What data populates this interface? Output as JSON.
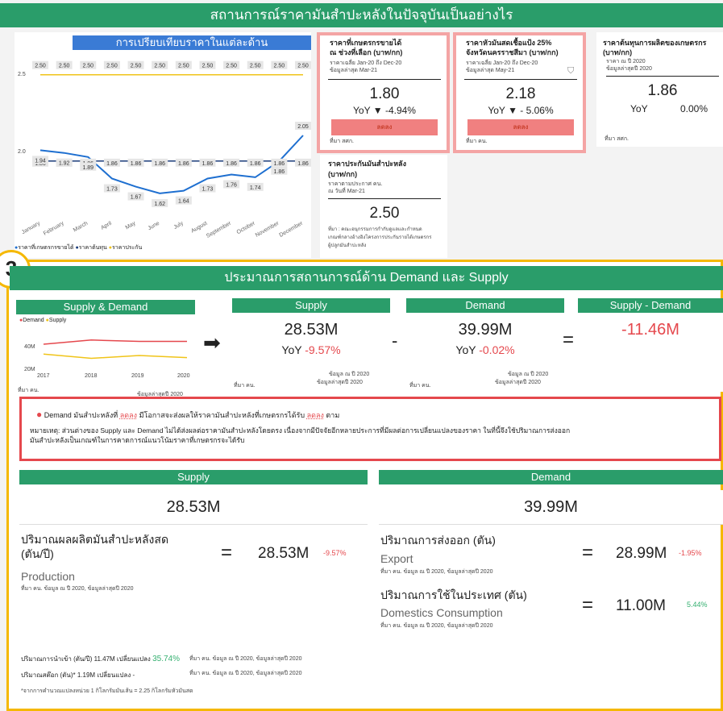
{
  "page": {
    "title": "สถานการณ์ราคามันสำปะหลังในปัจจุบันเป็นอย่างไร",
    "section_number": "3"
  },
  "compare": {
    "title": "การเปรียบเทียบราคาในแต่ละด้าน",
    "legend": [
      {
        "label": "ราคาที่เกษตรกรขายได้",
        "color": "#1e6fd0"
      },
      {
        "label": "ราคาต้นทุน",
        "color": "#1a3b7a"
      },
      {
        "label": "ราคาประกัน",
        "color": "#f0c419"
      }
    ],
    "y_ticks": [
      "2.5",
      "2.0"
    ]
  },
  "chart_data": {
    "type": "line",
    "categories": [
      "January",
      "February",
      "March",
      "April",
      "May",
      "June",
      "July",
      "August",
      "September",
      "October",
      "November",
      "December"
    ],
    "series": [
      {
        "name": "ราคาประกัน",
        "color": "#f0c419",
        "values": [
          2.5,
          2.5,
          2.5,
          2.5,
          2.5,
          2.5,
          2.5,
          2.5,
          2.5,
          2.5,
          2.5,
          2.5
        ]
      },
      {
        "name": "ราคาต้นทุน",
        "color": "#1a3b7a",
        "values": [
          1.86,
          1.86,
          1.86,
          1.86,
          1.86,
          1.86,
          1.86,
          1.86,
          1.86,
          1.86,
          1.86,
          1.86
        ]
      },
      {
        "name": "ราคาที่เกษตรกรขายได้",
        "color": "#1e6fd0",
        "values": [
          1.94,
          1.92,
          1.89,
          1.73,
          1.67,
          1.62,
          1.64,
          1.73,
          1.76,
          1.74,
          1.86,
          2.05
        ]
      }
    ],
    "labels": {
      "top": [
        "2.50",
        "2.50",
        "2.50",
        "2.50",
        "2.50",
        "2.50",
        "2.50",
        "2.50",
        "2.50",
        "2.50",
        "2.50",
        "2.50"
      ],
      "mid": [
        "1.86",
        "1.86",
        "1.86",
        "1.86",
        "1.86",
        "1.86",
        "1.86",
        "1.86",
        "1.86",
        "1.86",
        "1.86",
        "1.86"
      ],
      "farm": [
        "1.94",
        "1.92",
        "1.89",
        "1.73",
        "1.67",
        "1.62",
        "1.64",
        "1.73",
        "1.76",
        "1.74",
        "1.86",
        "2.05"
      ],
      "farm2": [
        "1.86",
        "1.88",
        "",
        "1.86"
      ]
    },
    "ylim": [
      1.5,
      2.6
    ]
  },
  "kpi1": {
    "title": "ราคาที่เกษตรกรขายได้",
    "title2": "ณ ช่วงที่เลือก (บาท/กก)",
    "note1": "ราคาเฉลี่ย Jan-20 ถึง Dec-20",
    "note2": "ข้อมูลล่าสุด Mar-21",
    "value": "1.80",
    "yoy_label": "YoY",
    "arrow": "▼",
    "yoy": "-4.94%",
    "status": "ลดลง",
    "source": "ที่มา สศก."
  },
  "kpi2": {
    "title": "ราคาหัวมันสดเชื้อแป้ง 25%",
    "title2": "จังหวัดนครราชสีมา (บาท/กก)",
    "note1": "ราคาเฉลี่ย Jan-20 ถึง Dec-20",
    "note2": "ข้อมูลล่าสุด May-21",
    "value": "2.18",
    "yoy_label": "YoY",
    "arrow": "▼",
    "yoy": "- 5.06%",
    "status": "ลดลง",
    "source": "ที่มา คน."
  },
  "kpi3": {
    "title": "ราคาต้นทุนการผลิตของเกษตรกร",
    "title2": "(บาท/กก)",
    "note1": "ราคา ณ ปี 2020",
    "note2": "ข้อมูลล่าสุดปี 2020",
    "value": "1.86",
    "yoy_label": "YoY",
    "yoy": "0.00%",
    "source": "ที่มา สศก."
  },
  "kpi4": {
    "title": "ราคาประกันมันสำปะหลัง",
    "title2": "(บาท/กก)",
    "note1": "ราคาตามประกาศ คน.",
    "note2": "ณ วันที่ Mar-21",
    "value": "2.50",
    "src1": "ที่มา : คณะอนุกรรมการกำกับดูแลและกำหนด",
    "src2": "เกณฑ์กลางอ้างอิงโครงการประกันรายได้เกษตรกร",
    "src3": "ผู้ปลูกมันสำปะหลัง"
  },
  "sd": {
    "title": "ประมาณการสถานการณ์ด้าน Demand และ Supply",
    "mini": {
      "title": "Supply & Demand",
      "legend": [
        "Demand",
        "Supply"
      ],
      "years": [
        "2017",
        "2018",
        "2019",
        "2020"
      ],
      "y_ticks": [
        "40M",
        "20M"
      ],
      "source": "ที่มา คน.",
      "latest": "ข้อมูลล่าสุดปี 2020"
    },
    "mini_chart": {
      "type": "line",
      "x": [
        "2017",
        "2018",
        "2019",
        "2020"
      ],
      "series": [
        {
          "name": "Demand",
          "color": "#e5484d",
          "values": [
            38,
            41,
            40,
            40
          ]
        },
        {
          "name": "Supply",
          "color": "#f0c419",
          "values": [
            31,
            28,
            30,
            28.5
          ]
        }
      ],
      "ylim": [
        18,
        50
      ]
    },
    "supply_card": {
      "title": "Supply",
      "value": "28.53M",
      "yoy_label": "YoY",
      "yoy": "-9.57%",
      "note": "ข้อมูล ณ ปี 2020",
      "latest": "ข้อมูลล่าสุดปี 2020",
      "source": "ที่มา คน."
    },
    "demand_card": {
      "title": "Demand",
      "value": "39.99M",
      "yoy_label": "YoY",
      "yoy": "-0.02%",
      "note": "ข้อมูล ณ ปี 2020",
      "latest": "ข้อมูลล่าสุดปี 2020",
      "source": "ที่มา คน."
    },
    "diff_card": {
      "title": "Supply - Demand",
      "value": "-11.46M"
    },
    "op_minus": "-",
    "op_equal": "="
  },
  "notice": {
    "l1a": "Demand มันสำปะหลังที่",
    "l1b": "ลดลง",
    "l1c": "มีโอกาสจะส่งผลให้ราคามันสำปะหลังที่เกษตรกรได้รับ",
    "l1d": "ลดลง",
    "l1e": "ตาม",
    "l2": "หมายเหตุ: ส่วนต่างของ Supply และ Demand ไม่ได้ส่งผลต่อราคามันสำปะหลังโดยตรง เนื่องจากมีปัจจัยอีกหลายประการที่มีผลต่อการเปลี่ยนแปลงของราคา ในที่นี้จึงใช้ปริมาณการส่งออก",
    "l3": "มันสำปะหลังเป็นเกณฑ์ในการคาดการณ์แนวโน้มราคาที่เกษตรกรจะได้รับ"
  },
  "supply": {
    "title": "Supply",
    "total": "28.53M",
    "prod_label1": "ปริมาณผลผลิตมันสำปะหลังสด",
    "prod_label2": "(ตัน/ปี)",
    "prod_en": "Production",
    "prod_src": "ที่มา คน. ข้อมูล ณ ปี 2020, ข้อมูลล่าสุดปี 2020",
    "eq": "=",
    "prod_value": "28.53M",
    "prod_change": "-9.57%",
    "import_label": "ปริมาณการนำเข้า (ตัน/ปี) 11.47M",
    "import_chg_label": "เปลี่ยนแปลง",
    "import_chg": "35.74%",
    "import_src": "ที่มา คน. ข้อมูล ณ ปี 2020, ข้อมูลล่าสุดปี 2020",
    "stock_label": "ปริมาณสต๊อก (ตัน)*",
    "stock_value": "1.19M",
    "stock_chg_label": "เปลี่ยนแปลง",
    "stock_chg": "-",
    "stock_src": "ที่มา คน. ข้อมูล ณ ปี 2020, ข้อมูลล่าสุดปี 2020",
    "footnote": "*จากการคำนวณแปลงหน่วย 1 กิโลกรัมมันเส้น = 2.25 กิโลกรัมหัวมันสด"
  },
  "demand": {
    "title": "Demand",
    "total": "39.99M",
    "exp_label": "ปริมาณการส่งออก (ตัน)",
    "exp_en": "Export",
    "exp_src": "ที่มา คน. ข้อมูล ณ ปี 2020, ข้อมูลล่าสุดปี 2020",
    "eq": "=",
    "exp_value": "28.99M",
    "exp_change": "-1.95%",
    "dom_label": "ปริมาณการใช้ในประเทศ (ตัน)",
    "dom_en": "Domestics Consumption",
    "dom_src": "ที่มา คน. ข้อมูล ณ ปี 2020, ข้อมูลล่าสุดปี 2020",
    "dom_value": "11.00M",
    "dom_change": "5.44%"
  }
}
